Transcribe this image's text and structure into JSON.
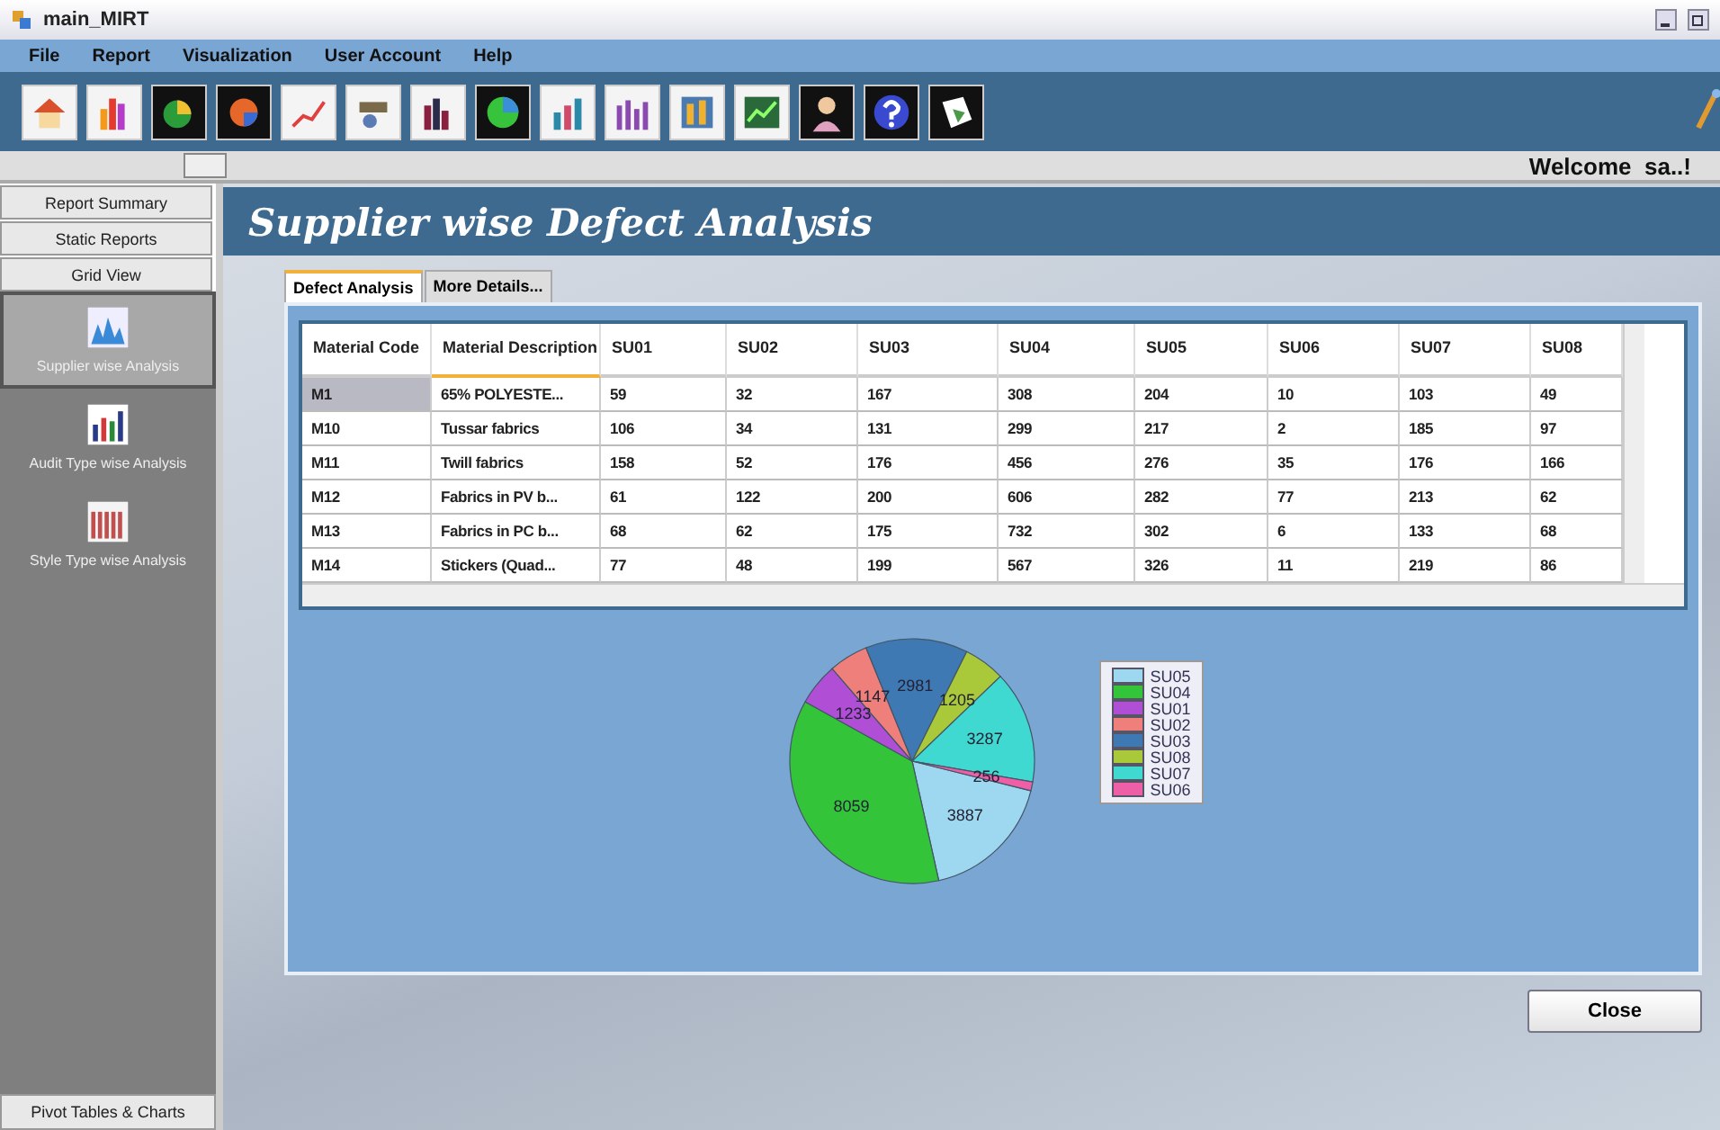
{
  "window": {
    "title": "main_MIRT"
  },
  "menu": [
    "File",
    "Report",
    "Visualization",
    "User Account",
    "Help"
  ],
  "welcome": "Welcome  sa..!",
  "sidebar": {
    "sections": [
      {
        "label": "Report Summary"
      },
      {
        "label": "Static Reports"
      },
      {
        "label": "Grid View"
      }
    ],
    "items": [
      {
        "label": "Supplier wise Analysis",
        "selected": true
      },
      {
        "label": "Audit Type wise Analysis",
        "selected": false
      },
      {
        "label": "Style Type wise Analysis",
        "selected": false
      }
    ],
    "footer": "Pivot Tables & Charts"
  },
  "page_title": "Supplier wise Defect Analysis",
  "tabs": [
    {
      "label": "Defect Analysis",
      "selected": true
    },
    {
      "label": "More Details...",
      "selected": false
    }
  ],
  "table": {
    "columns": [
      "Material Code",
      "Material Description",
      "SU01",
      "SU02",
      "SU03",
      "SU04",
      "SU05",
      "SU06",
      "SU07",
      "SU08"
    ],
    "rows": [
      {
        "selected": true,
        "cells": [
          "M1",
          "65% POLYESTE...",
          "59",
          "32",
          "167",
          "308",
          "204",
          "10",
          "103",
          "49"
        ]
      },
      {
        "selected": false,
        "cells": [
          "M10",
          "Tussar fabrics",
          "106",
          "34",
          "131",
          "299",
          "217",
          "2",
          "185",
          "97"
        ]
      },
      {
        "selected": false,
        "cells": [
          "M11",
          "Twill fabrics",
          "158",
          "52",
          "176",
          "456",
          "276",
          "35",
          "176",
          "166"
        ]
      },
      {
        "selected": false,
        "cells": [
          "M12",
          "Fabrics in PV b...",
          "61",
          "122",
          "200",
          "606",
          "282",
          "77",
          "213",
          "62"
        ]
      },
      {
        "selected": false,
        "cells": [
          "M13",
          "Fabrics in PC b...",
          "68",
          "62",
          "175",
          "732",
          "302",
          "6",
          "133",
          "68"
        ]
      },
      {
        "selected": false,
        "cells": [
          "M14",
          "Stickers (Quad...",
          "77",
          "48",
          "199",
          "567",
          "326",
          "11",
          "219",
          "86"
        ]
      }
    ]
  },
  "chart": {
    "chart_data": {
      "type": "pie",
      "categories": [
        "SU05",
        "SU04",
        "SU01",
        "SU02",
        "SU03",
        "SU08",
        "SU07",
        "SU06"
      ],
      "series": [
        {
          "values": [
            3887,
            8059,
            1233,
            1147,
            2981,
            1205,
            3287,
            256
          ]
        }
      ],
      "data_labels": true
    },
    "legend": [
      {
        "color": "#9dd8f0"
      },
      {
        "color": "#33c43a"
      },
      {
        "color": "#b04fd6"
      },
      {
        "color": "#ef7f7a"
      },
      {
        "color": "#3f79b3"
      },
      {
        "color": "#a9c93a"
      },
      {
        "color": "#3fd9d2"
      },
      {
        "color": "#ef5fa8"
      }
    ]
  },
  "close_button": "Close"
}
